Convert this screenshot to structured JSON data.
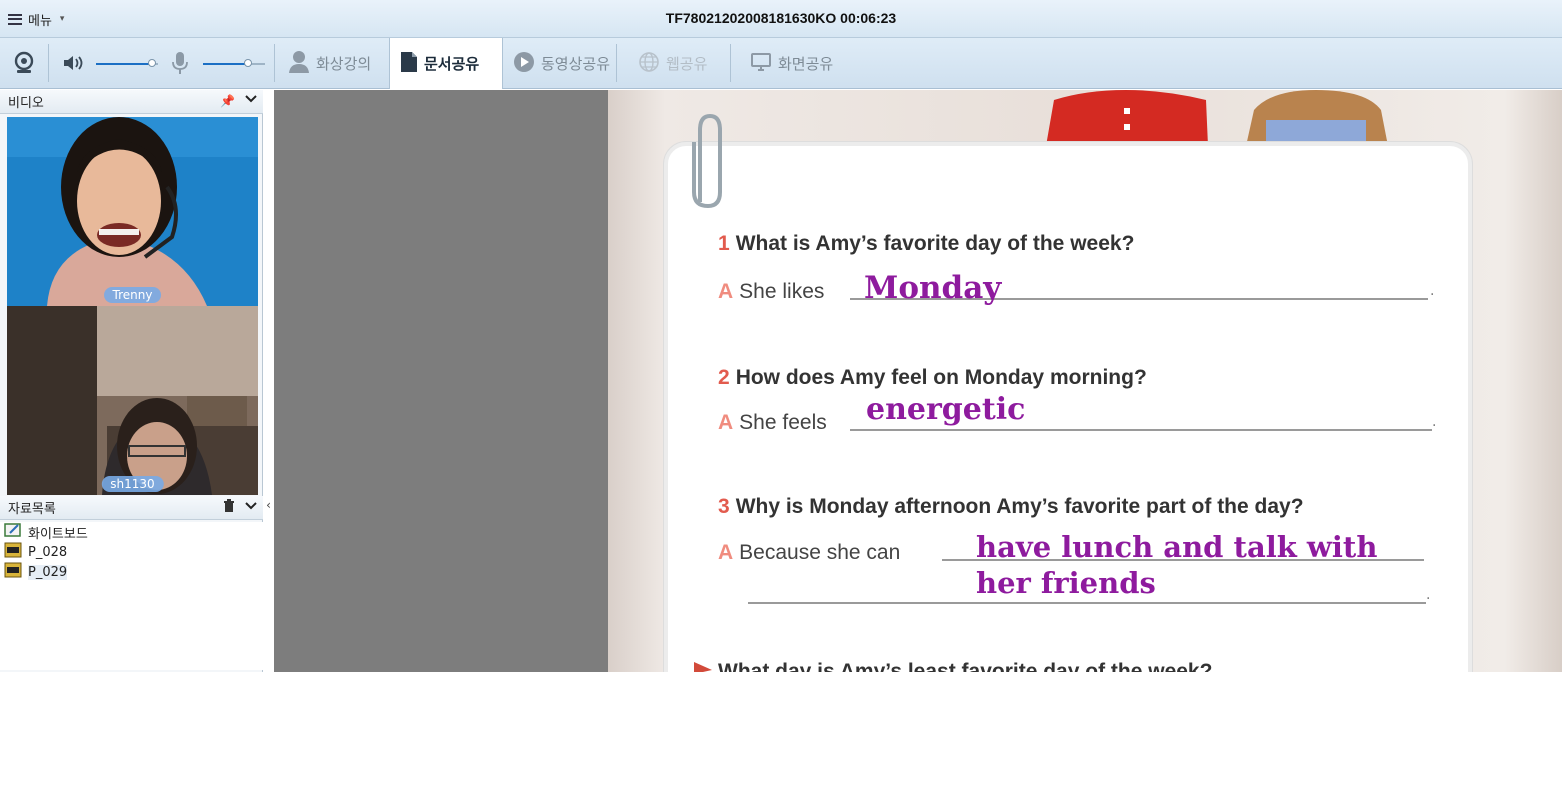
{
  "window": {
    "menu_label": "메뉴",
    "session_title": "TF78021202008181630KO 00:06:23"
  },
  "toolbar": {
    "tabs": [
      {
        "label": "화상강의",
        "icon": "user-icon",
        "state": "normal"
      },
      {
        "label": "문서공유",
        "icon": "document-icon",
        "state": "active"
      },
      {
        "label": "동영상공유",
        "icon": "play-icon",
        "state": "normal"
      },
      {
        "label": "웹공유",
        "icon": "globe-icon",
        "state": "disabled"
      },
      {
        "label": "화면공유",
        "icon": "monitor-icon",
        "state": "normal"
      }
    ],
    "speaker_level": 0.9,
    "mic_level": 0.72
  },
  "video_panel": {
    "title": "비디오",
    "participants": [
      {
        "name": "Trenny"
      },
      {
        "name": "sh1130"
      }
    ]
  },
  "files_panel": {
    "title": "자료목록",
    "items": [
      {
        "name": "화이트보드",
        "icon": "whiteboard-icon"
      },
      {
        "name": "P_028",
        "icon": "img-file-icon"
      },
      {
        "name": "P_029",
        "icon": "img-file-icon",
        "selected": true
      }
    ]
  },
  "document": {
    "questions": [
      {
        "num": "1",
        "text": "What is Amy’s favorite day of the week?",
        "answer_prefix": "She likes",
        "handwritten": "Monday"
      },
      {
        "num": "2",
        "text": "How does Amy feel on Monday morning?",
        "answer_prefix": "She feels",
        "handwritten": "energetic"
      },
      {
        "num": "3",
        "text": "Why is Monday afternoon Amy’s favorite part of the day?",
        "answer_prefix": "Because she can",
        "handwritten": "have lunch and talk with",
        "handwritten_2": "her friends"
      }
    ],
    "answer_letter": "A",
    "partial_next_question": "What day is Amy’s least favorite day of the week?"
  },
  "colors": {
    "handwriting": "#8e1b9e",
    "question_number": "#e25b4e",
    "answer_letter": "#f08c7f"
  }
}
